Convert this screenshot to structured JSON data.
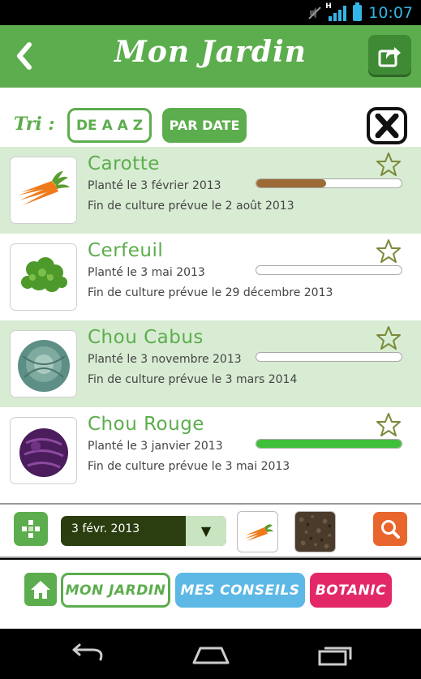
{
  "status_bar": {
    "time": "10:07",
    "network": "H",
    "icons": [
      "mute-icon",
      "signal-icon",
      "battery-icon"
    ]
  },
  "header": {
    "title": "Mon Jardin",
    "back_icon": "chevron-left-icon",
    "share_icon": "share-icon"
  },
  "sort": {
    "label": "Tri :",
    "az_label": "DE A A Z",
    "date_label": "PAR DATE",
    "close_icon": "close-icon"
  },
  "plants": [
    {
      "name": "Carotte",
      "planted": "Planté le 3 février 2013",
      "end": "Fin de culture prévue le 2 août 2013",
      "progress": 0.48,
      "progress_color": "#9c6b35",
      "alt": true,
      "image": "carrot"
    },
    {
      "name": "Cerfeuil",
      "planted": "Planté le 3 mai 2013",
      "end": "Fin de culture prévue le 29 décembre 2013",
      "progress": 0,
      "progress_color": "#9c6b35",
      "alt": false,
      "image": "chervil"
    },
    {
      "name": "Chou Cabus",
      "planted": "Planté le 3 novembre 2013",
      "end": "Fin de culture prévue le 3 mars 2014",
      "progress": 0,
      "progress_color": "#9c6b35",
      "alt": true,
      "image": "cabbage"
    },
    {
      "name": "Chou Rouge",
      "planted": "Planté le 3 janvier 2013",
      "end": "Fin de culture prévue le 3 mai 2013",
      "progress": 1,
      "progress_color": "#3fc03a",
      "alt": false,
      "image": "red-cabbage"
    }
  ],
  "toolbar": {
    "date_value": "3 févr. 2013",
    "move_icon": "move-icon",
    "search_icon": "search-icon"
  },
  "nav": {
    "home_icon": "home-icon",
    "tab_jardin": "MON JARDIN",
    "tab_conseils": "MES CONSEILS",
    "tab_botanic": "BOTANIC"
  },
  "colors": {
    "brand_green": "#5cad4d",
    "row_alt": "#d8ecd3",
    "conseils_blue": "#5db8e6",
    "botanic_pink": "#e32868",
    "search_orange": "#e8662d",
    "status_blue": "#33b5e5"
  }
}
